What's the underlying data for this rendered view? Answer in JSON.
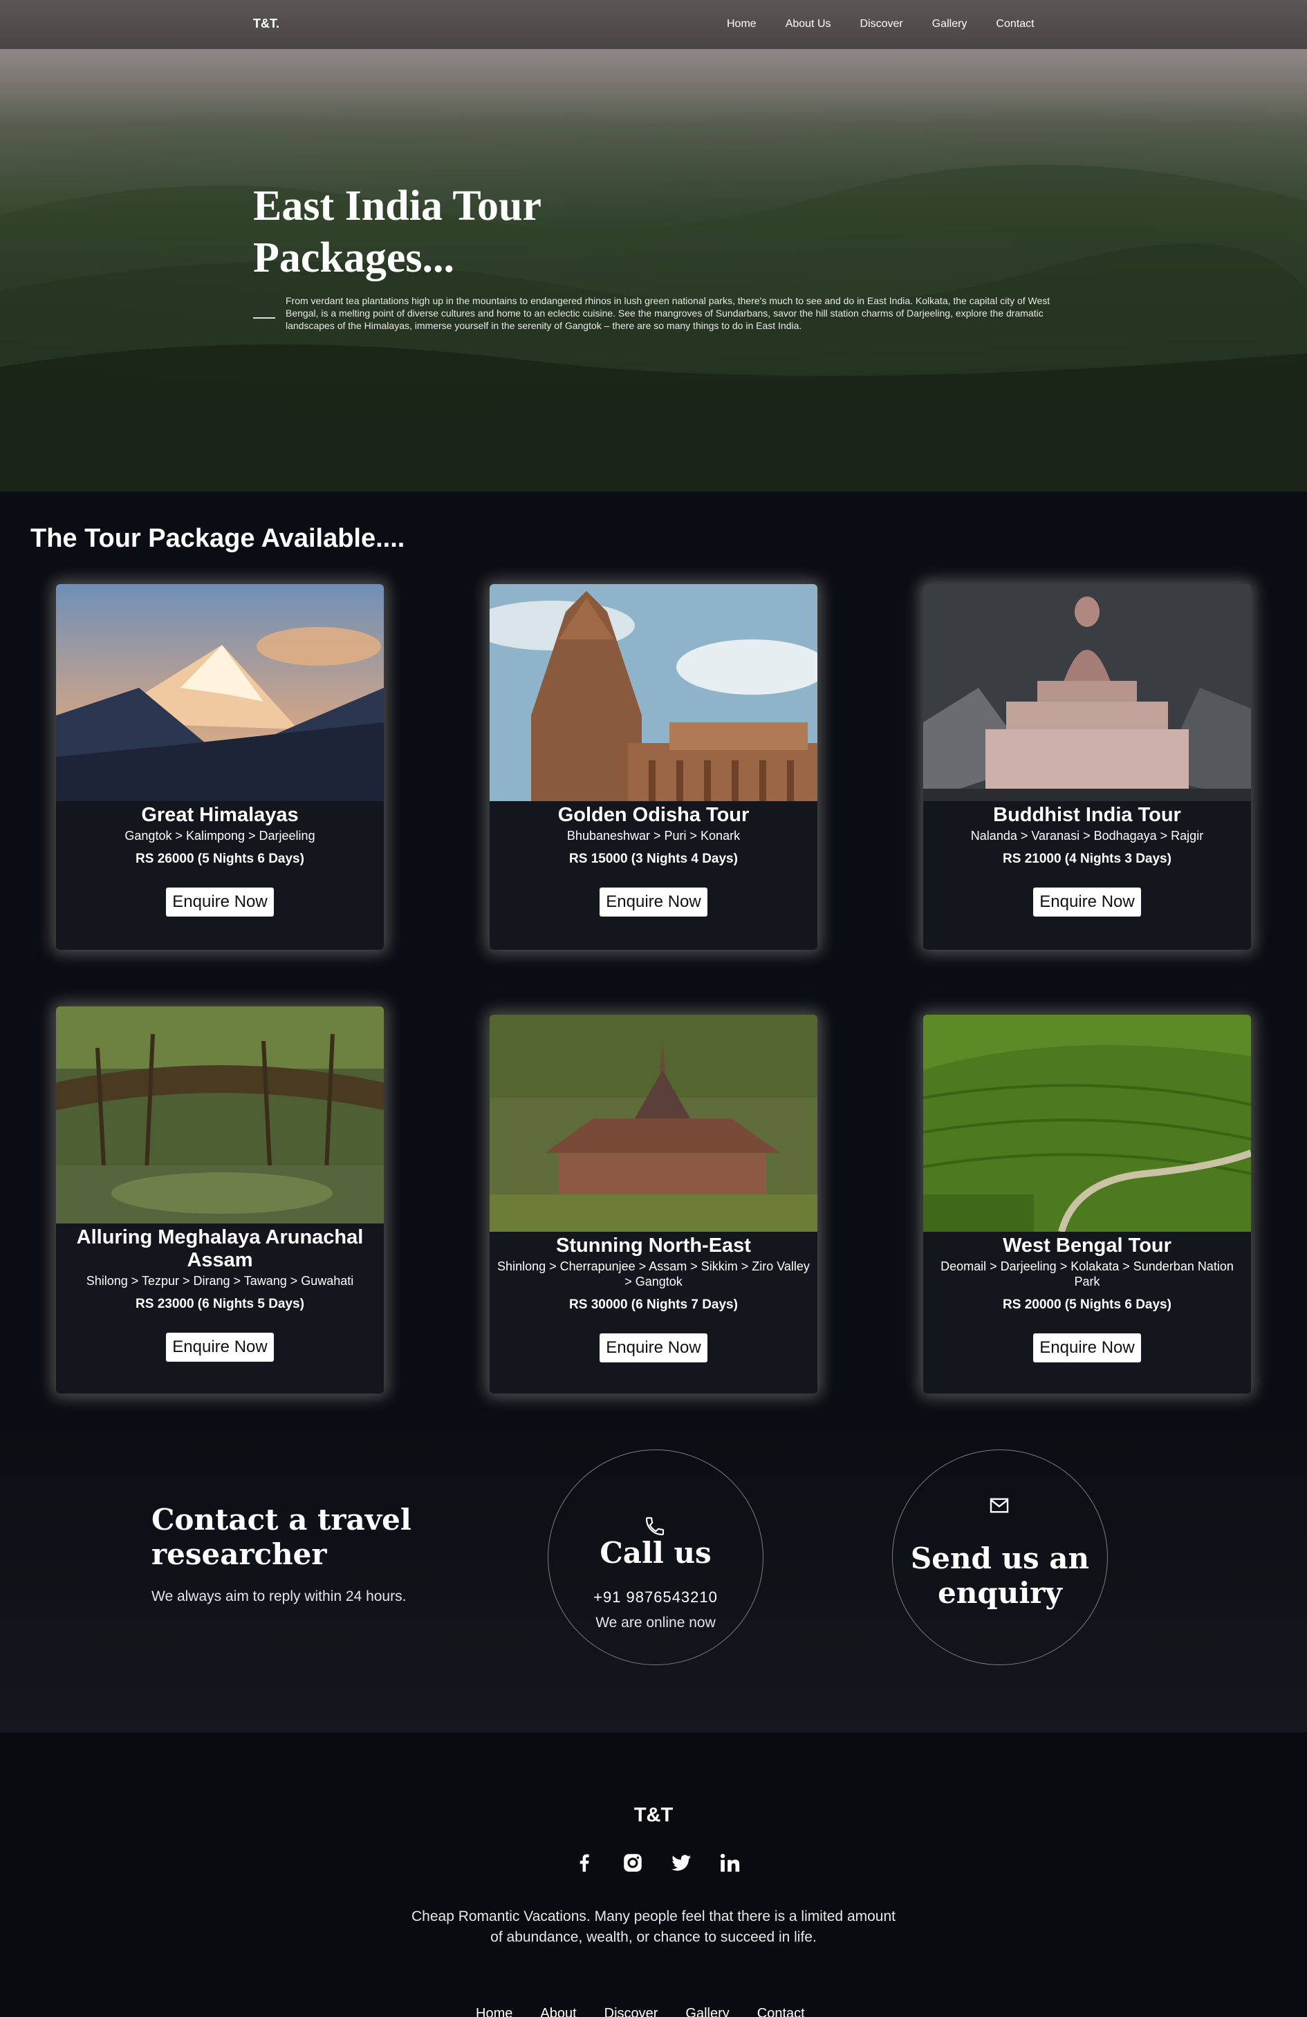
{
  "nav": {
    "brand": "T&T.",
    "links": [
      "Home",
      "About Us",
      "Discover",
      "Gallery",
      "Contact"
    ]
  },
  "hero": {
    "title": "East India Tour Packages...",
    "description": "From verdant tea plantations high up in the mountains to endangered rhinos in lush green national parks, there's much to see and do in East India. Kolkata, the capital city of West Bengal, is a melting point of diverse cultures and home to an eclectic cuisine. See the mangroves of Sundarbans, savor the hill station charms of Darjeeling, explore the dramatic landscapes of the Himalayas, immerse yourself in the serenity of Gangtok – there are so many things to do in East India."
  },
  "packages": {
    "section_title": "The Tour Package Available....",
    "button_label": "Enquire Now",
    "items": [
      {
        "title": "Great Himalayas",
        "route": "Gangtok > Kalimpong > Darjeeling",
        "price": "RS 26000 (5 Nights 6 Days)"
      },
      {
        "title": "Golden Odisha Tour",
        "route": "Bhubaneshwar > Puri > Konark",
        "price": "RS 15000 (3 Nights 4 Days)"
      },
      {
        "title": "Buddhist India Tour",
        "route": "Nalanda > Varanasi > Bodhagaya > Rajgir",
        "price": "RS 21000 (4 Nights 3 Days)"
      },
      {
        "title": "Alluring Meghalaya Arunachal Assam",
        "route": "Shilong > Tezpur > Dirang > Tawang > Guwahati",
        "price": "RS 23000 (6 Nights 5 Days)"
      },
      {
        "title": "Stunning North-East",
        "route": "Shinlong > Cherrapunjee > Assam > Sikkim > Ziro Valley > Gangtok",
        "price": "RS 30000 (6 Nights 7 Days)"
      },
      {
        "title": "West Bengal Tour",
        "route": "Deomail > Darjeeling > Kolakata > Sunderban Nation Park",
        "price": "RS 20000 (5 Nights 6 Days)"
      }
    ]
  },
  "contact": {
    "title": "Contact a travel researcher",
    "subtitle": "We always aim to reply within 24 hours.",
    "call_title": "Call us",
    "phone": "+91  9876543210",
    "online": "We are online now",
    "enquiry_title": "Send us an enquiry"
  },
  "footer": {
    "brand": "T&T",
    "social": [
      "facebook-icon",
      "instagram-icon",
      "twitter-icon",
      "linkedin-icon"
    ],
    "text": "Cheap Romantic Vacations. Many people feel that there is a limited amount of abundance, wealth, or chance to succeed in life.",
    "links": [
      "Home",
      "About",
      "Discover",
      "Gallery",
      "Contact"
    ]
  }
}
